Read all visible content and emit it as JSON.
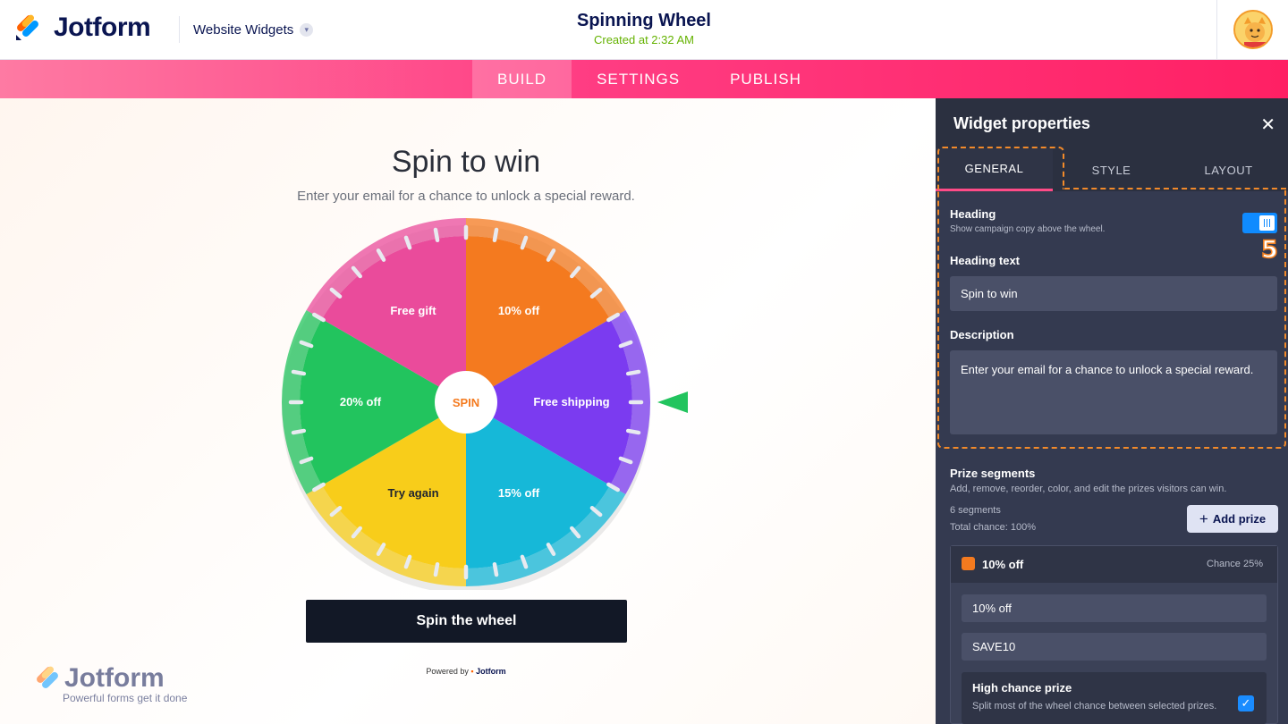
{
  "header": {
    "logo_text": "Jotform",
    "brand_menu": "Website Widgets",
    "title": "Spinning Wheel",
    "subtitle": "Created at 2:32 AM"
  },
  "nav": {
    "tabs": [
      "BUILD",
      "SETTINGS",
      "PUBLISH"
    ],
    "active": "BUILD"
  },
  "widget": {
    "heading": "Spin to win",
    "description": "Enter your email for a chance to unlock a special reward.",
    "center_label": "SPIN",
    "segments": [
      {
        "label": "10% off",
        "color": "#f47a1f"
      },
      {
        "label": "Free shipping",
        "color": "#7b3bf0"
      },
      {
        "label": "15% off",
        "color": "#16b8d8"
      },
      {
        "label": "Try again",
        "color": "#f8cd1a"
      },
      {
        "label": "20% off",
        "color": "#22c45e"
      },
      {
        "label": "Free gift",
        "color": "#ea4b9b"
      }
    ],
    "pointer_color": "#22c45e",
    "button_label": "Spin the wheel",
    "powered_prefix": "Powered by",
    "powered_brand": "Jotform",
    "watermark_brand": "Jotform",
    "watermark_tagline": "Powerful forms get it done"
  },
  "panel": {
    "title": "Widget properties",
    "tabs": [
      "GENERAL",
      "STYLE",
      "LAYOUT"
    ],
    "active_tab": "GENERAL",
    "heading_toggle": {
      "label": "Heading",
      "hint": "Show campaign copy above the wheel.",
      "on": true
    },
    "step_number": "5",
    "heading_text": {
      "label": "Heading text",
      "value": "Spin to win"
    },
    "description": {
      "label": "Description",
      "value": "Enter your email for a chance to unlock a special reward."
    },
    "prizes": {
      "label": "Prize segments",
      "hint": "Add, remove, reorder, color, and edit the prizes visitors can win.",
      "count": "6 segments",
      "total": "Total chance: 100%",
      "add_label": "Add prize"
    },
    "prize_item": {
      "name": "10% off",
      "chance": "Chance 25%",
      "swatch_color": "#f47a1f",
      "label_value": "10% off",
      "code_value": "SAVE10",
      "high_chance": {
        "label": "High chance prize",
        "hint": "Split most of the wheel chance between selected prizes.",
        "checked": true
      }
    }
  }
}
